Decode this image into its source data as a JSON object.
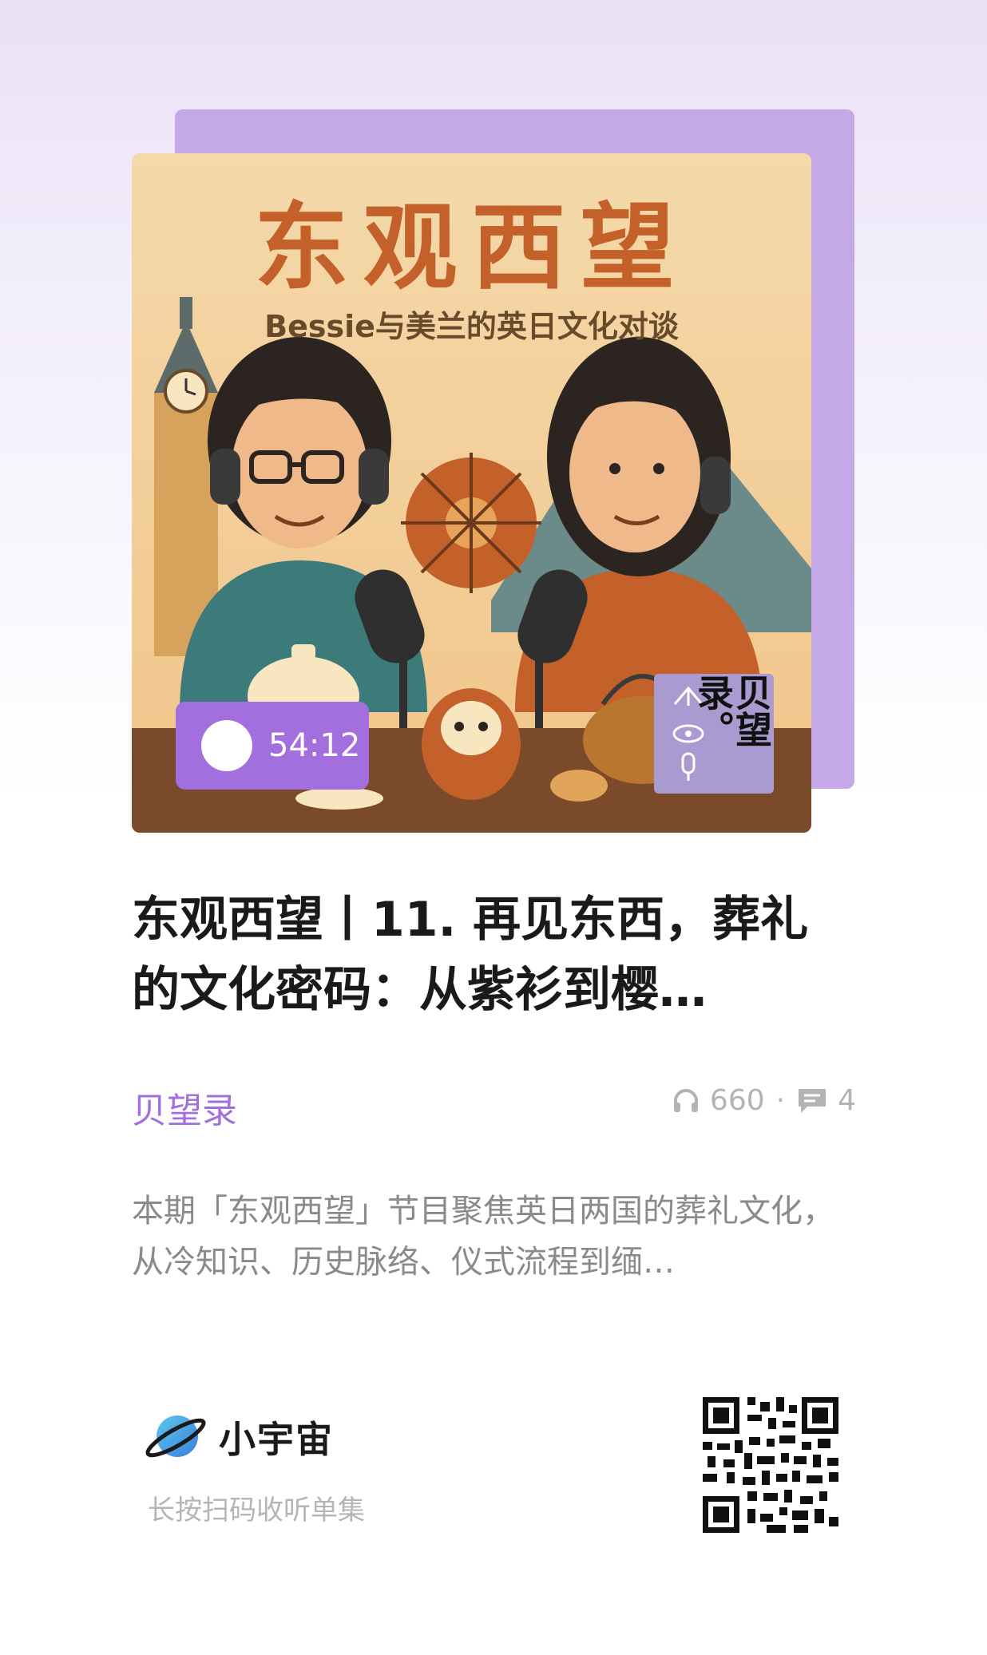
{
  "cover": {
    "title": "东观西望",
    "subtitle": "Bessie与美兰的英日文化对谈",
    "duration": "54:12",
    "badge_text": "贝望录。"
  },
  "episode": {
    "title": "东观西望丨11. 再见东西，葬礼的文化密码：从紫衫到樱…",
    "podcast": "贝望录",
    "plays": "660",
    "separator": "·",
    "comments": "4",
    "description": "本期「东观西望」节目聚焦英日两国的葬礼文化，从冷知识、历史脉络、仪式流程到缅…"
  },
  "footer": {
    "brand": "小宇宙",
    "scan_hint": "长按扫码收听单集"
  },
  "colors": {
    "accent": "#a36ede",
    "cover_bg": "#f4d4a4",
    "title_orange": "#c4602a"
  }
}
